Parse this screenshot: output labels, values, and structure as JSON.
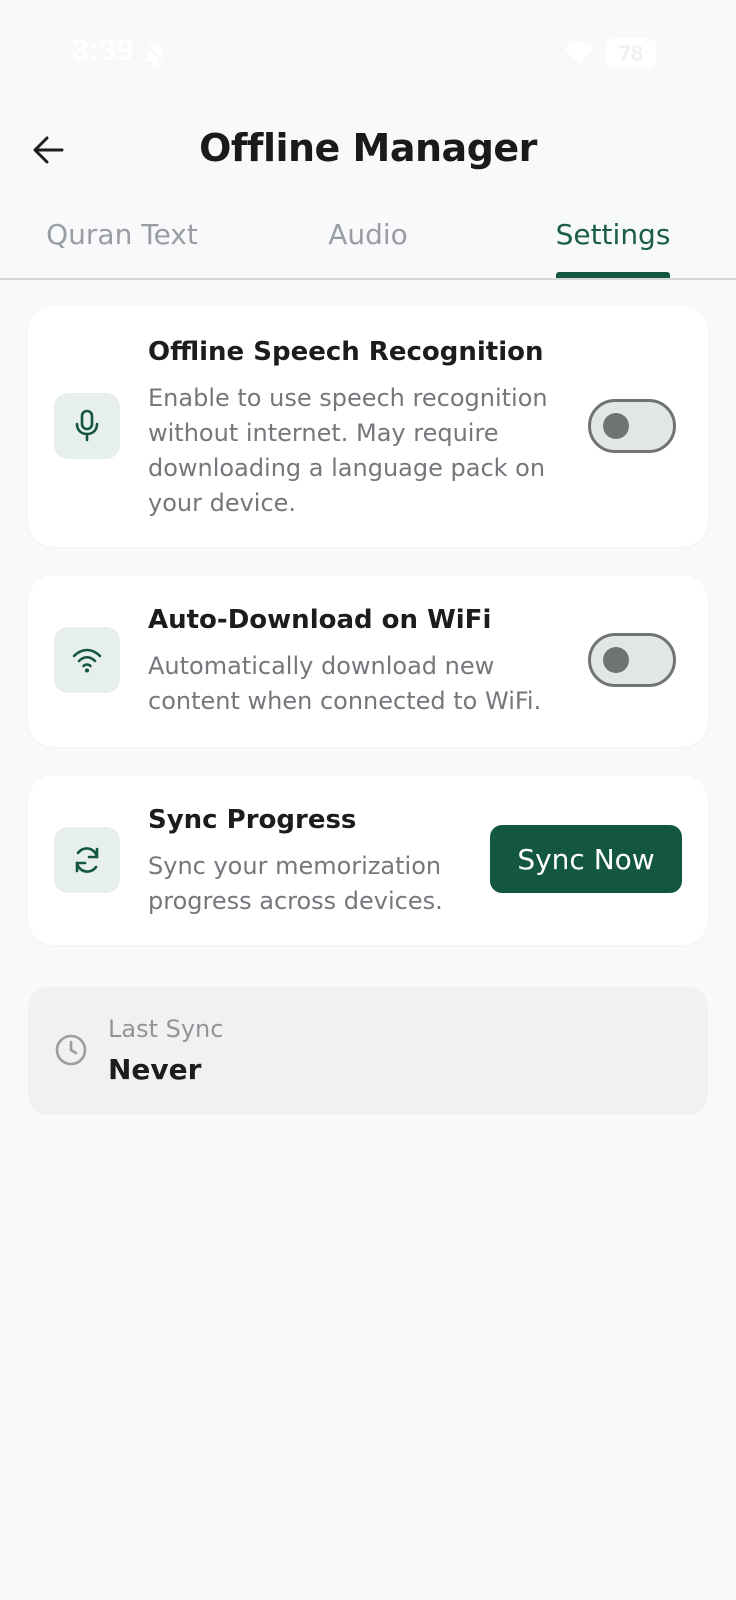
{
  "status_bar": {
    "time": "3:39",
    "battery": "78"
  },
  "header": {
    "title": "Offline Manager"
  },
  "tabs": [
    {
      "label": "Quran Text",
      "active": false
    },
    {
      "label": "Audio",
      "active": false
    },
    {
      "label": "Settings",
      "active": true
    }
  ],
  "settings": {
    "speech": {
      "title": "Offline Speech Recognition",
      "description": "Enable to use speech recognition without internet. May require downloading a language pack on your device.",
      "enabled": false,
      "icon": "microphone-icon"
    },
    "wifi": {
      "title": "Auto-Download on WiFi",
      "description": "Automatically download new content when connected to WiFi.",
      "enabled": false,
      "icon": "wifi-icon"
    },
    "sync": {
      "title": "Sync Progress",
      "description": "Sync your memorization progress across devices.",
      "button_label": "Sync Now",
      "icon": "sync-icon"
    }
  },
  "last_sync": {
    "label": "Last Sync",
    "value": "Never",
    "icon": "clock-icon"
  },
  "colors": {
    "accent": "#14573f",
    "background": "#f8f9fb",
    "card": "#ffffff",
    "icon_bg": "#e7efec"
  }
}
